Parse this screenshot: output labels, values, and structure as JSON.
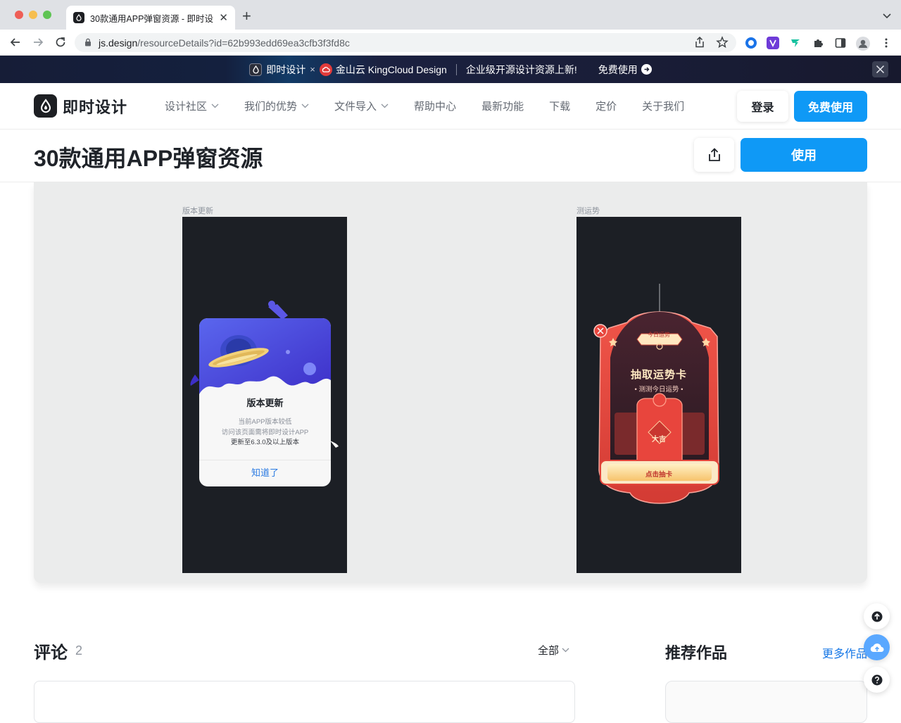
{
  "browser": {
    "tab_title": "30款通用APP弹窗资源 - 即时设计",
    "url_host": "js.design",
    "url_path": "/resourceDetails?id=62b993edd69ea3cfb3f3fd8c"
  },
  "promo": {
    "brand1": "即时设计",
    "times": "×",
    "brand2": "金山云 KingCloud Design",
    "message": "企业级开源设计资源上新!",
    "cta": "免费使用"
  },
  "header": {
    "brand": "即时设计",
    "nav": [
      "设计社区",
      "我们的优势",
      "文件导入",
      "帮助中心",
      "最新功能",
      "下载",
      "定价",
      "关于我们"
    ],
    "login": "登录",
    "free": "免费使用"
  },
  "page": {
    "title": "30款通用APP弹窗资源",
    "use": "使用"
  },
  "preview": {
    "frame1_label": "版本更新",
    "frame2_label": "测运势",
    "update": {
      "title": "版本更新",
      "line1": "当前APP版本较低",
      "line2": "访问该页面需将即时设计APP",
      "line3": "更新至6.3.0及以上版本",
      "button": "知道了"
    },
    "fortune": {
      "badge": "今日运势",
      "title": "抽取运势卡",
      "subtitle": "• 测测今日运势 •",
      "card": "大吉",
      "button": "点击抽卡"
    }
  },
  "comments": {
    "title": "评论",
    "count": "2",
    "filter": "全部"
  },
  "recommend": {
    "title": "推荐作品",
    "more": "更多作品"
  },
  "colors": {
    "primary": "#0f99f6",
    "banner_bg": "#161d37",
    "dark_frame": "#1c1f25",
    "fortune_red": "#e8473f"
  }
}
